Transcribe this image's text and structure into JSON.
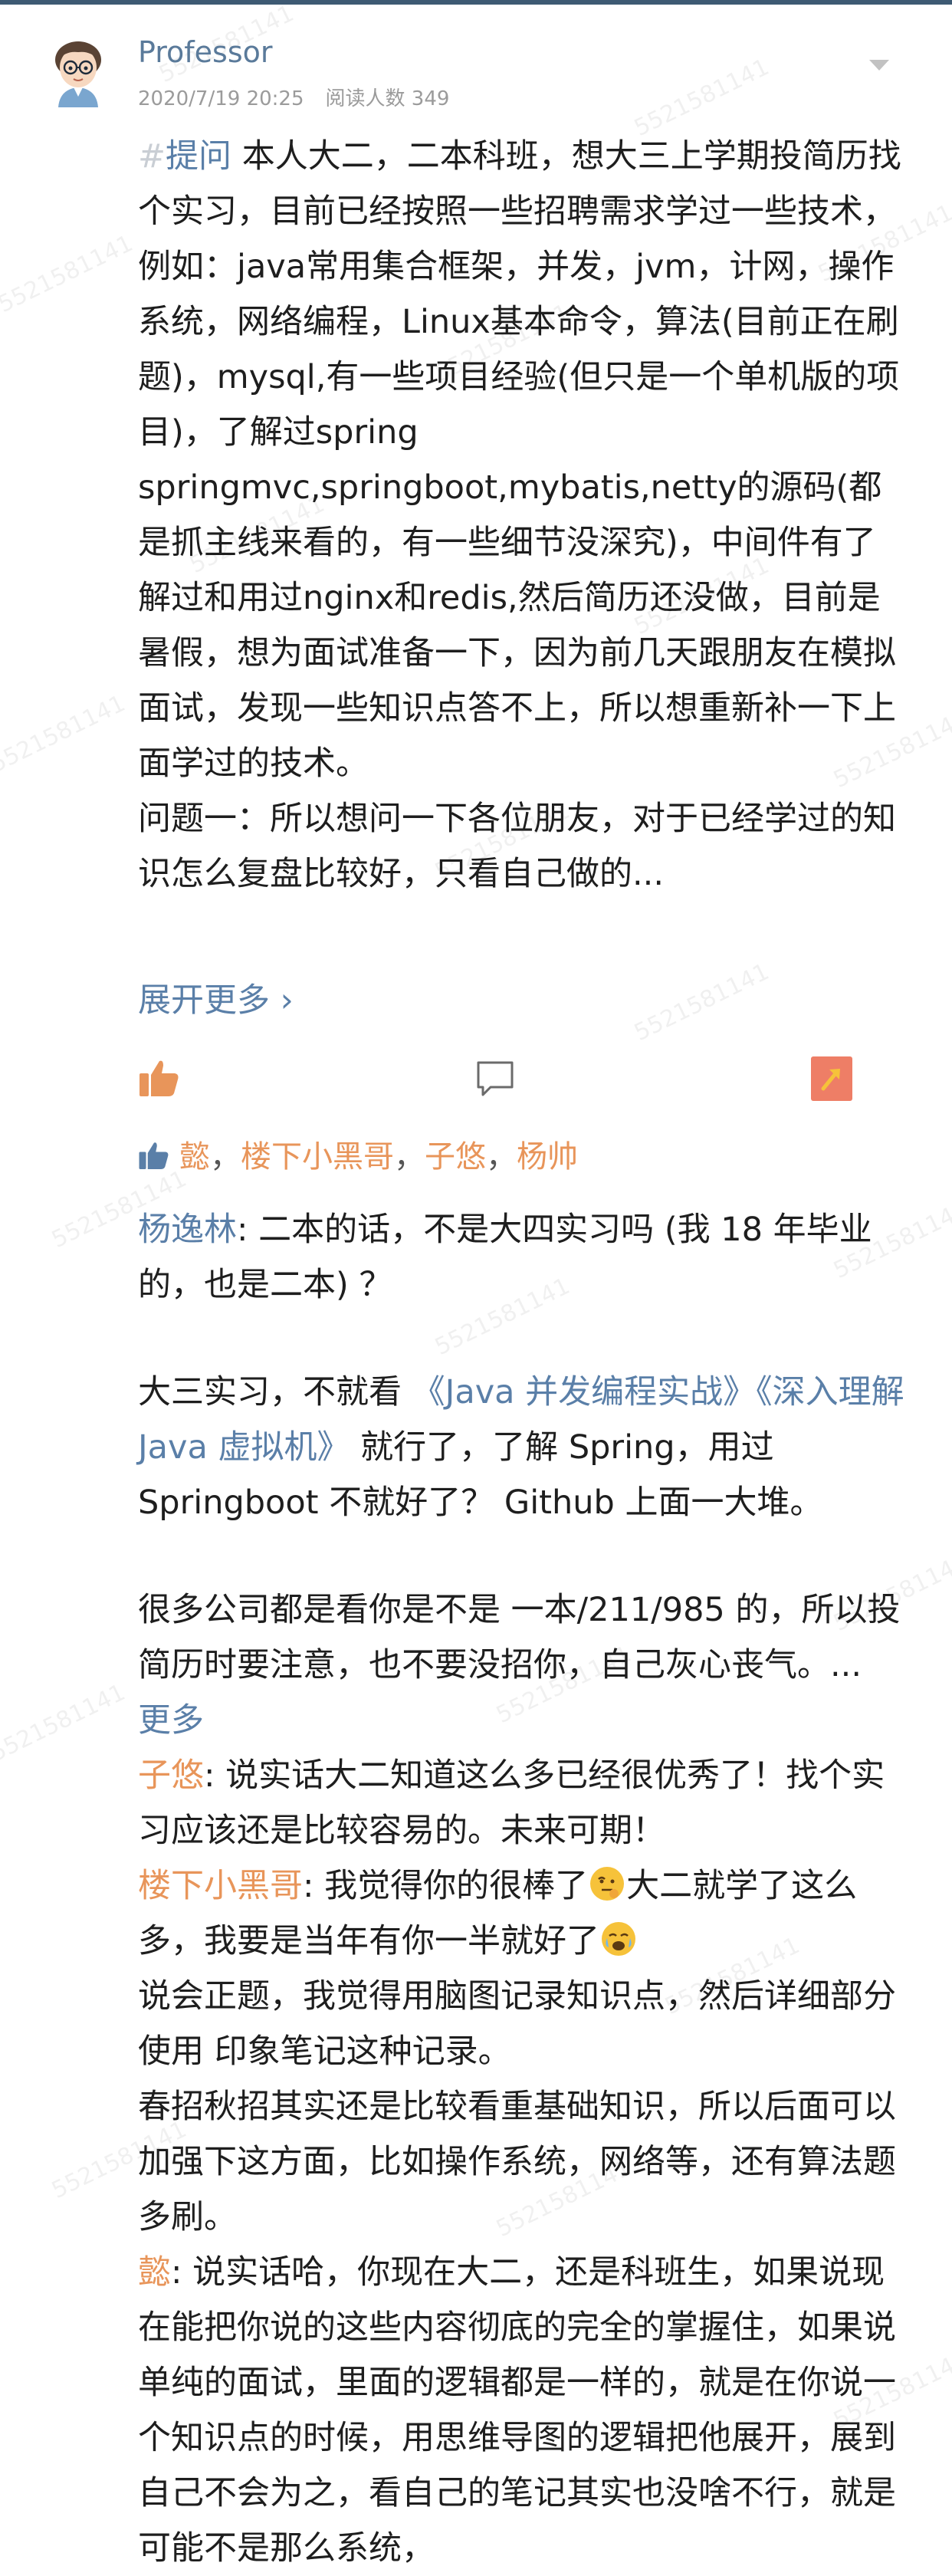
{
  "post": {
    "author": "Professor",
    "date": "2020/7/19 20:25",
    "views": "阅读人数 349",
    "tag_hash": "#",
    "tag": "提问",
    "body": " 本人大二，二本科班，想大三上学期投简历找个实习，目前已经按照一些招聘需求学过一些技术，例如：java常用集合框架，并发，jvm，计网，操作系统，网络编程，Linux基本命令，算法(目前正在刷题)，mysql,有一些项目经验(但只是一个单机版的项目)，了解过spring springmvc,springboot,mybatis,netty的源码(都是抓主线来看的，有一些细节没深究)，中间件有了解过和用过nginx和redis,然后简历还没做，目前是暑假，想为面试准备一下，因为前几天跟朋友在模拟面试，发现一些知识点答不上，所以想重新补一下上面学过的技术。",
    "question": "问题一：所以想问一下各位朋友，对于已经学过的知识怎么复盘比较好，只看自己做的...",
    "expand": "展开更多 ›"
  },
  "likers": {
    "names": [
      "懿",
      "楼下小黑哥",
      "子悠",
      "杨帅"
    ],
    "separator": "，"
  },
  "comments": [
    {
      "author": "杨逸林",
      "lines": [
        {
          "text": ": 二本的话，不是大四实习吗 (我 18 年毕业的，也是二本) ？"
        },
        {
          "text": "大三实习，不就看 "
        },
        {
          "text": "《Java 并发编程实战》《深入理解 Java 虚拟机》"
        },
        {
          "text": " 就行了，了解 Spring，用过 Springboot 不就好了？ Github 上面一大堆。"
        },
        {
          "text": "很多公司都是看你是不是 一本/211/985 的，所以投简历时要注意，也不要没招你，自己灰心丧气。... "
        },
        {
          "text": "更多"
        }
      ]
    },
    {
      "author": "子悠",
      "text": ": 说实话大二知道这么多已经很优秀了！找个实习应该还是比较容易的。未来可期！"
    },
    {
      "author": "楼下小黑哥",
      "text1": ": 我觉得你的很棒了",
      "text2": "大二就学了这么多，我要是当年有你一半就好了",
      "text3": "说会正题，我觉得用脑图记录知识点，然后详细部分使用 印象笔记这种记录。",
      "text4": "春招秋招其实还是比较看重基础知识，所以后面可以加强下这方面，比如操作系统，网络等，还有算法题多刷。"
    },
    {
      "author": "懿",
      "text": ": 说实话哈，你现在大二，还是科班生，如果说现在能把你说的这些内容彻底的完全的掌握住，如果说单纯的面试，里面的逻辑都是一样的，就是在你说一个知识点的时候，用思维导图的逻辑把他展开，展到自己不会为之，看自己的笔记其实也没啥不行，就是可能不是那么系统，"
    }
  ],
  "watermark": "5521581141",
  "colors": {
    "link": "#5a7fa8",
    "liker": "#e8955a",
    "meta": "#9b9b9b"
  },
  "icons": [
    "avatar",
    "more-icon",
    "like-icon",
    "comment-icon",
    "share-icon",
    "emoji-thinking-icon",
    "emoji-crying-icon"
  ]
}
